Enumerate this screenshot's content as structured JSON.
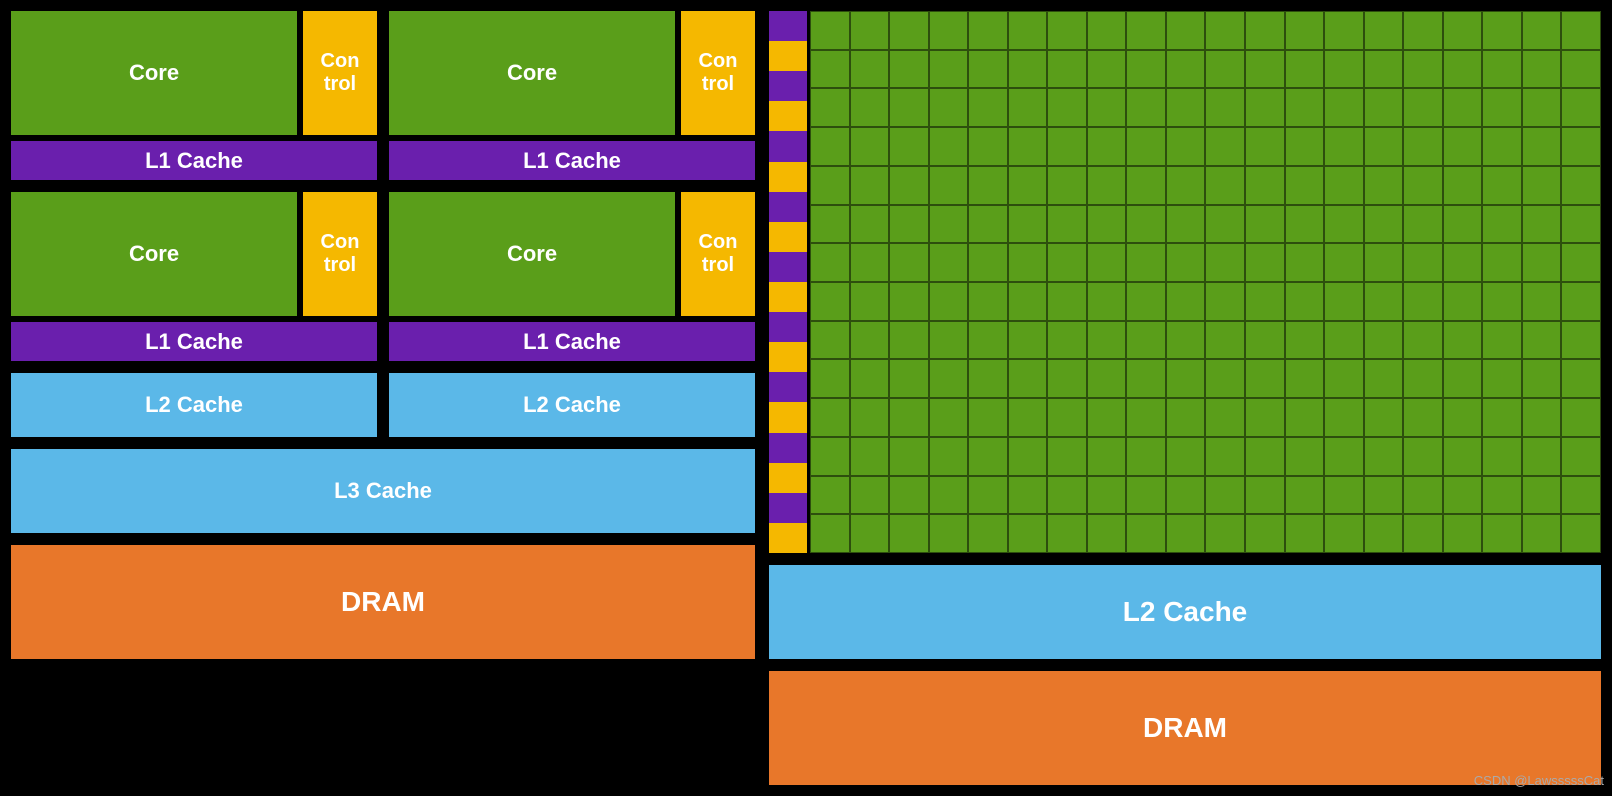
{
  "left": {
    "core1": "Core",
    "core2": "Core",
    "core3": "Core",
    "core4": "Core",
    "control": "Con\ntrol",
    "l1cache": "L1 Cache",
    "l2cache": "L2 Cache",
    "l3cache": "L3 Cache",
    "dram": "DRAM"
  },
  "right": {
    "l2cache": "L2 Cache",
    "dram": "DRAM"
  },
  "watermark": "CSDN @LawsssssCat",
  "colors": {
    "green": "#5a9e1a",
    "yellow": "#f5b800",
    "purple": "#6a1fad",
    "blue": "#5bb8e8",
    "orange": "#e8772a"
  }
}
